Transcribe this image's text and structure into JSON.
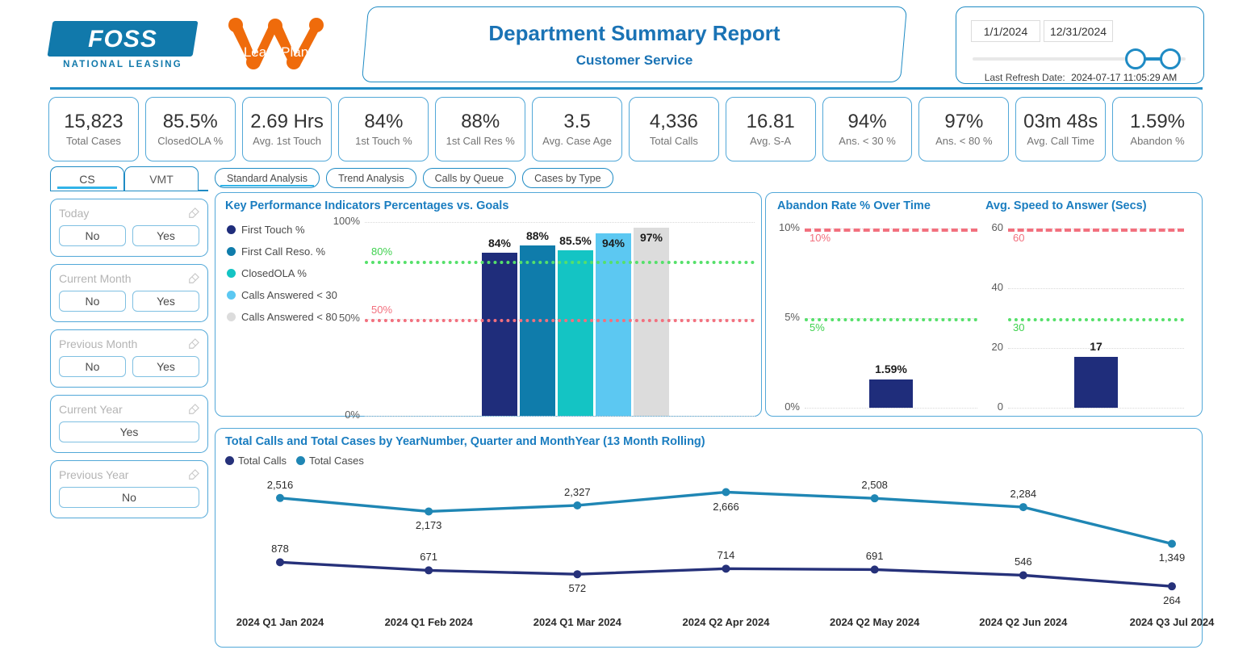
{
  "header": {
    "foss_logo_text": "FOSS",
    "foss_logo_sub": "NATIONAL LEASING",
    "leaseplan_logo_text": "LeasePlan",
    "title": "Department Summary Report",
    "subtitle": "Customer Service",
    "date_from": "1/1/2024",
    "date_to": "12/31/2024",
    "refresh_label": "Last Refresh Date:",
    "refresh_value": "2024-07-17 11:05:29 AM"
  },
  "kpis": [
    {
      "value": "15,823",
      "label": "Total Cases"
    },
    {
      "value": "85.5%",
      "label": "ClosedOLA %"
    },
    {
      "value": "2.69 Hrs",
      "label": "Avg. 1st Touch"
    },
    {
      "value": "84%",
      "label": "1st Touch %"
    },
    {
      "value": "88%",
      "label": "1st Call Res %"
    },
    {
      "value": "3.5",
      "label": "Avg. Case Age"
    },
    {
      "value": "4,336",
      "label": "Total Calls"
    },
    {
      "value": "16.81",
      "label": "Avg. S-A"
    },
    {
      "value": "94%",
      "label": "Ans. < 30 %"
    },
    {
      "value": "97%",
      "label": "Ans. < 80 %"
    },
    {
      "value": "03m 48s",
      "label": "Avg. Call Time"
    },
    {
      "value": "1.59%",
      "label": "Abandon %"
    }
  ],
  "sidebar": {
    "tabs": [
      {
        "label": "CS",
        "active": true
      },
      {
        "label": "VMT",
        "active": false
      }
    ],
    "filters": [
      {
        "title": "Today",
        "options": [
          "No",
          "Yes"
        ]
      },
      {
        "title": "Current Month",
        "options": [
          "No",
          "Yes"
        ]
      },
      {
        "title": "Previous Month",
        "options": [
          "No",
          "Yes"
        ]
      },
      {
        "title": "Current Year",
        "options": [
          "Yes"
        ]
      },
      {
        "title": "Previous Year",
        "options": [
          "No"
        ]
      }
    ]
  },
  "nav_buttons": [
    {
      "label": "Standard Analysis",
      "active": true
    },
    {
      "label": "Trend Analysis",
      "active": false
    },
    {
      "label": "Calls by Queue",
      "active": false
    },
    {
      "label": "Cases by Type",
      "active": false
    }
  ],
  "colors": {
    "brand_blue": "#1f8bc4",
    "title_blue": "#1a73b5",
    "orange": "#ef6b0b",
    "navy": "#1f2d7b",
    "mid_blue": "#0f7cab",
    "teal": "#14c4c4",
    "light_blue": "#5cc8f2",
    "grey": "#dcdcdc",
    "goal_green": "#3fd14f",
    "goal_red": "#f2707e",
    "line_calls": "#26317a",
    "line_cases": "#1f86b4"
  },
  "chart_data": [
    {
      "type": "bar",
      "title": "Key Performance Indicators Percentages vs. Goals",
      "categories": [
        "First Touch %",
        "First Call Reso. %",
        "ClosedOLA %",
        "Calls Answered < 30",
        "Calls Answered < 80"
      ],
      "values": [
        84,
        88,
        85.5,
        94,
        97
      ],
      "value_labels": [
        "84%",
        "88%",
        "85.5%",
        "94%",
        "97%"
      ],
      "colors": [
        "#1f2d7b",
        "#0f7cab",
        "#14c4c4",
        "#5cc8f2",
        "#dcdcdc"
      ],
      "legend": [
        "First Touch %",
        "First Call Reso. %",
        "ClosedOLA %",
        "Calls Answered < 30",
        "Calls Answered < 80"
      ],
      "ylabel": "",
      "xlabel": "",
      "ylim": [
        0,
        100
      ],
      "yticks": [
        "0%",
        "50%",
        "100%"
      ],
      "goal_lines": [
        {
          "value": 80,
          "label": "80%",
          "color": "#3fd14f",
          "style": "dotted"
        },
        {
          "value": 50,
          "label": "50%",
          "color": "#f2707e",
          "style": "dotted"
        }
      ],
      "grid": true,
      "legend_position": "left"
    },
    {
      "type": "bar",
      "title": "Abandon Rate % Over Time",
      "categories": [
        ""
      ],
      "values": [
        1.59
      ],
      "value_labels": [
        "1.59%"
      ],
      "colors": [
        "#1f2d7b"
      ],
      "ylim": [
        0,
        10
      ],
      "yticks": [
        "0%",
        "5%",
        "10%"
      ],
      "goal_lines": [
        {
          "value": 10,
          "label": "10%",
          "color": "#f2707e",
          "style": "dashed"
        },
        {
          "value": 5,
          "label": "5%",
          "color": "#3fd14f",
          "style": "dotted"
        }
      ],
      "grid": true
    },
    {
      "type": "bar",
      "title": "Avg. Speed to Answer (Secs)",
      "categories": [
        ""
      ],
      "values": [
        17
      ],
      "value_labels": [
        "17"
      ],
      "colors": [
        "#1f2d7b"
      ],
      "ylim": [
        0,
        60
      ],
      "yticks": [
        "0",
        "20",
        "40",
        "60"
      ],
      "goal_lines": [
        {
          "value": 60,
          "label": "60",
          "color": "#f2707e",
          "style": "dashed"
        },
        {
          "value": 30,
          "label": "30",
          "color": "#3fd14f",
          "style": "dotted"
        }
      ],
      "grid": true
    },
    {
      "type": "line",
      "title": "Total Calls and Total Cases by YearNumber, Quarter and MonthYear (13 Month Rolling)",
      "categories": [
        "2024 Q1 Jan 2024",
        "2024 Q1 Feb 2024",
        "2024 Q1 Mar 2024",
        "2024 Q2 Apr 2024",
        "2024 Q2 May 2024",
        "2024 Q2 Jun 2024",
        "2024 Q3 Jul 2024"
      ],
      "series": [
        {
          "name": "Total Calls",
          "color": "#26317a",
          "values": [
            878,
            671,
            572,
            714,
            691,
            546,
            264
          ],
          "value_labels": [
            "878",
            "671",
            "572",
            "714",
            "691",
            "546",
            "264"
          ]
        },
        {
          "name": "Total Cases",
          "color": "#1f86b4",
          "values": [
            2516,
            2173,
            2327,
            2666,
            2508,
            2284,
            1349
          ],
          "value_labels": [
            "2,516",
            "2,173",
            "2,327",
            "2,666",
            "2,508",
            "2,284",
            "1,349"
          ]
        }
      ],
      "ylim": [
        0,
        2800
      ],
      "grid": false,
      "legend_position": "top-left"
    }
  ]
}
